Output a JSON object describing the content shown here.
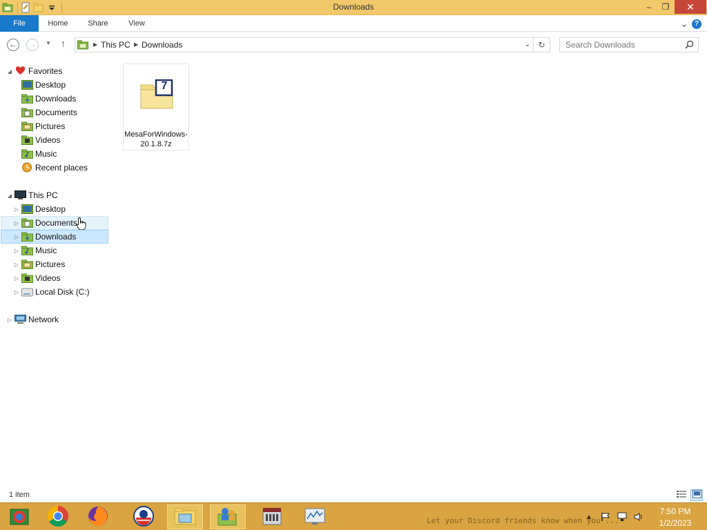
{
  "window": {
    "title": "Downloads",
    "minimize": "–",
    "maximize": "❐",
    "close": "✕"
  },
  "ribbon": {
    "tabs": [
      {
        "label": "File"
      },
      {
        "label": "Home"
      },
      {
        "label": "Share"
      },
      {
        "label": "View"
      }
    ],
    "expand": "⌄",
    "help": "?"
  },
  "address": {
    "crumbs": [
      "This PC",
      "Downloads"
    ],
    "search_placeholder": "Search Downloads"
  },
  "nav": {
    "favorites": {
      "label": "Favorites",
      "items": [
        {
          "label": "Desktop"
        },
        {
          "label": "Downloads"
        },
        {
          "label": "Documents"
        },
        {
          "label": "Pictures"
        },
        {
          "label": "Videos"
        },
        {
          "label": "Music"
        },
        {
          "label": "Recent places"
        }
      ]
    },
    "thispc": {
      "label": "This PC",
      "items": [
        {
          "label": "Desktop"
        },
        {
          "label": "Documents"
        },
        {
          "label": "Downloads"
        },
        {
          "label": "Music"
        },
        {
          "label": "Pictures"
        },
        {
          "label": "Videos"
        },
        {
          "label": "Local Disk (C:)"
        }
      ]
    },
    "network": {
      "label": "Network"
    }
  },
  "files": [
    {
      "name": "MesaForWindows-20.1.8.7z",
      "icon": "7z-archive-icon",
      "badge": "7"
    }
  ],
  "status": {
    "item_count": "1 item"
  },
  "taskbar": {
    "apps": [
      "file-explorer-icon",
      "chrome-icon",
      "firefox-icon",
      "obama-logo-icon",
      "file-explorer-icon",
      "users-icon",
      "device-icon",
      "performance-monitor-icon"
    ],
    "ticker": "Let your Discord friends know when you ... ",
    "time": "7:50 PM",
    "date": "1/2/2023"
  },
  "colors": {
    "titlebar": "#f2c96a",
    "file_tab": "#1979ca",
    "selection": "#cce8ff",
    "taskbar": "#d9a441"
  }
}
